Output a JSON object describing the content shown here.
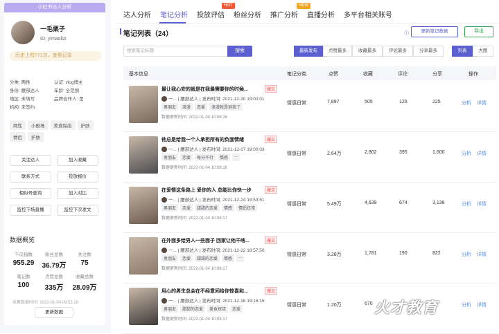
{
  "sidebar": {
    "header": "小红书达人分析",
    "name": "一毛栗子",
    "id": "ID: yimaolizi",
    "history": "历史上榜771次，查看记录",
    "meta": [
      [
        "分类: 两性",
        "认证: vlog博主"
      ],
      [
        "身份: 腰部达人",
        "年龄: 全范围"
      ],
      [
        "地区: 未填写",
        "品牌合作人: 是"
      ],
      [
        "机构: 未签约",
        ""
      ]
    ],
    "tags": [
      "两性",
      "小剧场",
      "情侣日常",
      "情感日常",
      "喜欢记录",
      "美食探店",
      "护肤",
      "情侣"
    ],
    "buttons": [
      "关注达人",
      "加入收藏",
      "联系方式",
      "投放报价",
      "相似号查询",
      "加入对比",
      "监控下场直播",
      "监控下次发文"
    ],
    "stats_title": "数据概览",
    "stats": [
      {
        "label": "千瓜指数",
        "value": "955.29"
      },
      {
        "label": "粉丝总数",
        "value": "36.79万"
      },
      {
        "label": "关注数",
        "value": "75"
      },
      {
        "label": "笔记数",
        "value": "100"
      },
      {
        "label": "点赞总数",
        "value": "335万"
      },
      {
        "label": "收藏总数",
        "value": "28.09万"
      }
    ],
    "update_time": "采集数据时间: 2022-01-04 09:53:28",
    "update_button": "更新数据"
  },
  "tabs": [
    {
      "label": "达人分析"
    },
    {
      "label": "笔记分析",
      "active": true
    },
    {
      "label": "投放评估",
      "badge": "HOT"
    },
    {
      "label": "粉丝分析"
    },
    {
      "label": "推广分析",
      "badge": "NEW"
    },
    {
      "label": "直播分析"
    },
    {
      "label": "多平台相关账号"
    }
  ],
  "list": {
    "title": "笔记列表（24）",
    "update_btn": "更新笔记数据",
    "export_btn": "导出",
    "search_placeholder": "搜索笔记标题",
    "search_btn": "搜索",
    "sorts": [
      "最新发布",
      "点赞最多",
      "收藏最多",
      "评论最多",
      "分享最多"
    ],
    "views": [
      "列表",
      "大图"
    ],
    "headers": [
      "基本信息",
      "笔记分类",
      "点赞",
      "收藏",
      "评论",
      "分享",
      "操作"
    ]
  },
  "rows": [
    {
      "title": "最让我心安的就是在我最需要你的时候...",
      "author": "一...",
      "role": "腰部达人",
      "date": "发布时间: 2021-12-30 19:00:01",
      "tags": [
        "男朋友",
        "浪漫",
        "恋爱",
        "浪漫就是到我了"
      ],
      "updated": "数据更新时间: 2022-01-04 10:08:16",
      "category": "情感日常",
      "likes": "7,897",
      "saves": "505",
      "comments": "125",
      "shares": "225"
    },
    {
      "title": "他总是给我一个人承担所有的负面情绪",
      "author": "一...",
      "role": "腰部达人",
      "date": "发布时间: 2021-12-27 19:00:03",
      "tags": [
        "男朋友",
        "恋爱",
        "每分不行",
        "情感",
        "..."
      ],
      "updated": "数据更新时间: 2022-01-04 10:08:16",
      "category": "情感日常",
      "likes": "2.64万",
      "saves": "2,802",
      "comments": "395",
      "shares": "1,600"
    },
    {
      "title": "在爱情这条路上 爱你的人 总能比你快一步",
      "author": "一...",
      "role": "腰部达人",
      "date": "发布时间: 2021-12-24 19:53:51",
      "tags": [
        "男朋友",
        "恋爱",
        "甜甜的恋爱",
        "情感",
        "情侣日常"
      ],
      "updated": "数据更新时间: 2022-01-04 10:08:17",
      "category": "情感日常",
      "likes": "5.49万",
      "saves": "4,639",
      "comments": "674",
      "shares": "3,138"
    },
    {
      "title": "在外面多给男人一些面子 回家让他干啥...",
      "author": "一...",
      "role": "腰部达人",
      "date": "发布时间: 2021-12-22 18:57:50",
      "tags": [
        "男朋友",
        "恋爱",
        "甜甜的恋爱",
        "情感",
        "..."
      ],
      "updated": "数据更新时间: 2022-01-04 10:08:17",
      "category": "情感日常",
      "likes": "3.28万",
      "saves": "1,781",
      "comments": "190",
      "shares": "822"
    },
    {
      "title": "用心的男生总会在不经意间给你惊喜和...",
      "author": "一...",
      "role": "腰部达人",
      "date": "发布时间: 2021-12-16 19:16:15",
      "tags": [
        "男朋友",
        "甜甜的恋爱",
        "美食探店",
        "恋爱"
      ],
      "updated": "数据更新时间: 2022-01-04 10:08:17",
      "category": "情感日常",
      "likes": "1.20万",
      "saves": "670",
      "comments": "",
      "shares": ""
    }
  ],
  "row_actions": [
    "分析",
    "详情"
  ],
  "hot_mark": "爆文",
  "watermark": "火才教育"
}
